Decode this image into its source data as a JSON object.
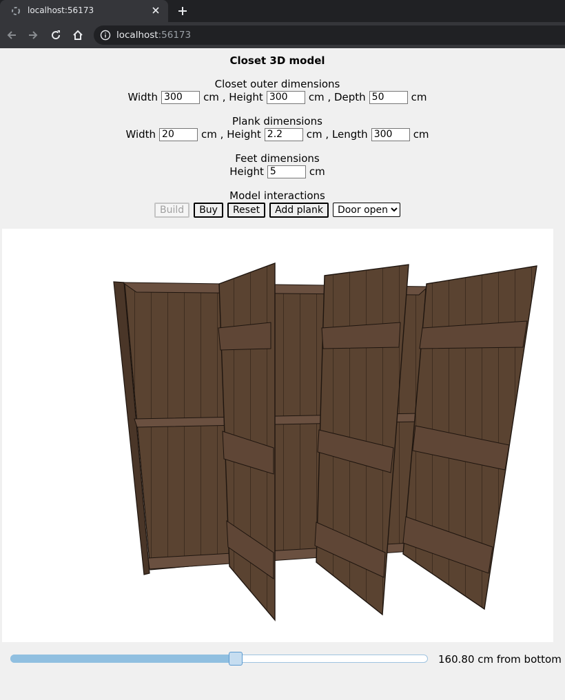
{
  "browser": {
    "tab_title": "localhost:56173",
    "url_host": "localhost",
    "url_port": ":56173"
  },
  "page": {
    "title": "Closet 3D model",
    "outer": {
      "heading": "Closet outer dimensions",
      "width_label": "Width",
      "width_value": "300",
      "height_label": "cm , Height",
      "height_value": "300",
      "depth_label": "cm , Depth",
      "depth_value": "50",
      "unit": "cm"
    },
    "plank": {
      "heading": "Plank dimensions",
      "width_label": "Width",
      "width_value": "20",
      "height_label": "cm , Height",
      "height_value": "2.2",
      "length_label": "cm , Length",
      "length_value": "300",
      "unit": "cm"
    },
    "feet": {
      "heading": "Feet dimensions",
      "height_label": "Height",
      "height_value": "5",
      "unit": "cm"
    },
    "interactions": {
      "heading": "Model interactions",
      "build": "Build",
      "buy": "Buy",
      "reset": "Reset",
      "add_plank": "Add plank",
      "door_select": "Door open"
    },
    "slider": {
      "fraction": 0.54,
      "label": "160.80 cm from bottom"
    },
    "colors": {
      "wood": "#5a4331",
      "wood_dark": "#3a2a1e",
      "accent": "#90bfe0"
    }
  }
}
